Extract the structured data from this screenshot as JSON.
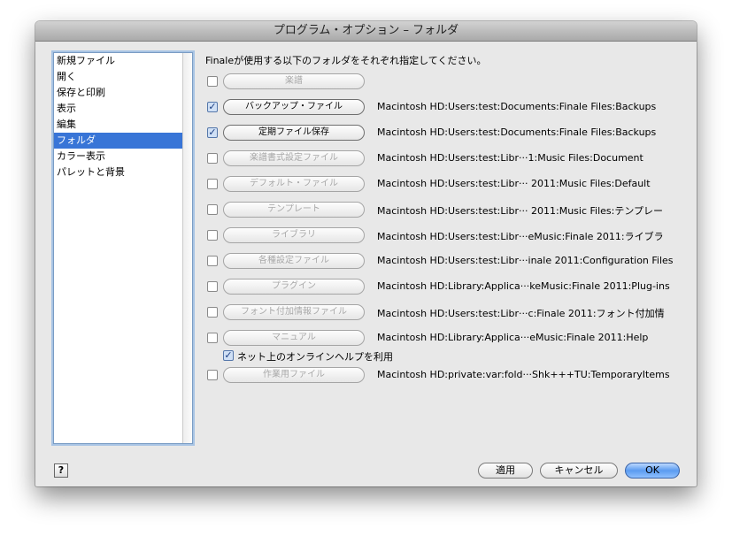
{
  "window": {
    "title": "プログラム・オプション – フォルダ"
  },
  "sidebar": {
    "items": [
      {
        "label": "新規ファイル",
        "selected": false
      },
      {
        "label": "開く",
        "selected": false
      },
      {
        "label": "保存と印刷",
        "selected": false
      },
      {
        "label": "表示",
        "selected": false
      },
      {
        "label": "編集",
        "selected": false
      },
      {
        "label": "フォルダ",
        "selected": true
      },
      {
        "label": "カラー表示",
        "selected": false
      },
      {
        "label": "パレットと背景",
        "selected": false
      }
    ]
  },
  "main": {
    "heading": "Finaleが使用する以下のフォルダをそれぞれ指定してください。",
    "folders": [
      {
        "label": "楽譜",
        "checked": false,
        "path": ""
      },
      {
        "label": "バックアップ・ファイル",
        "checked": true,
        "path": "Macintosh HD:Users:test:Documents:Finale Files:Backups"
      },
      {
        "label": "定期ファイル保存",
        "checked": true,
        "path": "Macintosh HD:Users:test:Documents:Finale Files:Backups"
      },
      {
        "label": "楽譜書式設定ファイル",
        "checked": false,
        "path": "Macintosh HD:Users:test:Libr···1:Music Files:Document"
      },
      {
        "label": "デフォルト・ファイル",
        "checked": false,
        "path": "Macintosh HD:Users:test:Libr··· 2011:Music Files:Default"
      },
      {
        "label": "テンプレート",
        "checked": false,
        "path": "Macintosh HD:Users:test:Libr··· 2011:Music Files:テンプレー"
      },
      {
        "label": "ライブラリ",
        "checked": false,
        "path": "Macintosh HD:Users:test:Libr···eMusic:Finale 2011:ライブラ"
      },
      {
        "label": "各種設定ファイル",
        "checked": false,
        "path": "Macintosh HD:Users:test:Libr···inale 2011:Configuration Files"
      },
      {
        "label": "プラグイン",
        "checked": false,
        "path": "Macintosh HD:Library:Applica···keMusic:Finale 2011:Plug-ins"
      },
      {
        "label": "フォント付加情報ファイル",
        "checked": false,
        "path": "Macintosh HD:Users:test:Libr···c:Finale 2011:フォント付加情"
      },
      {
        "label": "マニュアル",
        "checked": false,
        "path": "Macintosh HD:Library:Applica···eMusic:Finale 2011:Help"
      }
    ],
    "online_help": {
      "label": "ネット上のオンラインヘルプを利用",
      "checked": true
    },
    "temp_folder": {
      "label": "作業用ファイル",
      "checked": false,
      "path": "Macintosh HD:private:var:fold···Shk+++TU:TemporaryItems"
    }
  },
  "footer": {
    "help_label": "?",
    "apply_label": "適用",
    "cancel_label": "キャンセル",
    "ok_label": "OK"
  },
  "colors": {
    "selection": "#3875d7",
    "default_button": "#5b9bf0"
  },
  "icons": {
    "check": "checkmark-icon"
  }
}
